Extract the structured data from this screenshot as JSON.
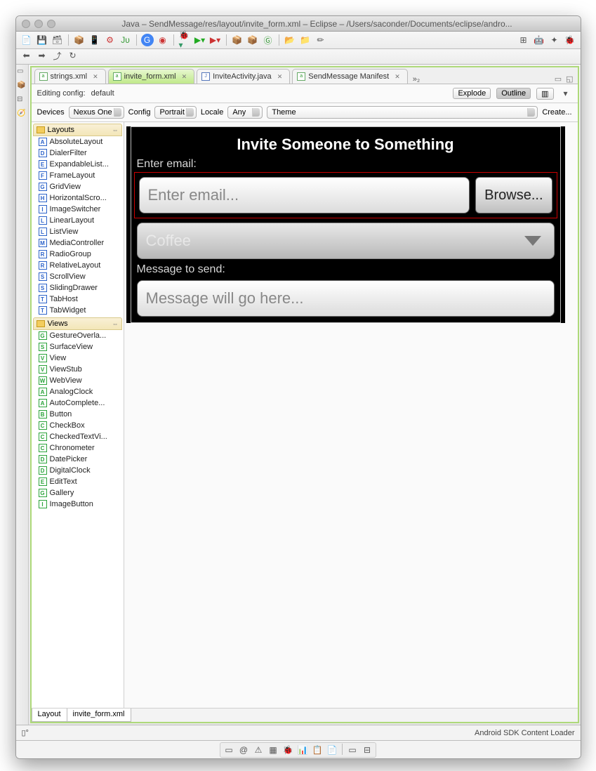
{
  "window": {
    "title": "Java – SendMessage/res/layout/invite_form.xml – Eclipse – /Users/saconder/Documents/eclipse/andro..."
  },
  "tabs": [
    {
      "label": "strings.xml",
      "active": false,
      "kind": "x"
    },
    {
      "label": "invite_form.xml",
      "active": true,
      "kind": "x"
    },
    {
      "label": "InviteActivity.java",
      "active": false,
      "kind": "j"
    },
    {
      "label": "SendMessage Manifest",
      "active": false,
      "kind": "x"
    }
  ],
  "tabs_more": "»₂",
  "cfg": {
    "prefix": "Editing config:",
    "value": "default",
    "explode": "Explode",
    "outline": "Outline"
  },
  "dev": {
    "devices_label": "Devices",
    "device": "Nexus One",
    "config_label": "Config",
    "config": "Portrait",
    "locale_label": "Locale",
    "locale": "Any",
    "theme": "Theme",
    "create": "Create..."
  },
  "palette": {
    "layouts_head": "Layouts",
    "layouts": [
      {
        "l": "A",
        "c": "#2b62c9",
        "t": "AbsoluteLayout"
      },
      {
        "l": "D",
        "c": "#2b62c9",
        "t": "DialerFilter"
      },
      {
        "l": "E",
        "c": "#2b62c9",
        "t": "ExpandableList..."
      },
      {
        "l": "F",
        "c": "#2b62c9",
        "t": "FrameLayout"
      },
      {
        "l": "G",
        "c": "#2b62c9",
        "t": "GridView"
      },
      {
        "l": "H",
        "c": "#2b62c9",
        "t": "HorizontalScro..."
      },
      {
        "l": "I",
        "c": "#2b62c9",
        "t": "ImageSwitcher"
      },
      {
        "l": "L",
        "c": "#2b62c9",
        "t": "LinearLayout"
      },
      {
        "l": "L",
        "c": "#2b62c9",
        "t": "ListView"
      },
      {
        "l": "M",
        "c": "#2b62c9",
        "t": "MediaController"
      },
      {
        "l": "R",
        "c": "#2b62c9",
        "t": "RadioGroup"
      },
      {
        "l": "R",
        "c": "#2b62c9",
        "t": "RelativeLayout"
      },
      {
        "l": "S",
        "c": "#2b62c9",
        "t": "ScrollView"
      },
      {
        "l": "S",
        "c": "#2b62c9",
        "t": "SlidingDrawer"
      },
      {
        "l": "T",
        "c": "#2b62c9",
        "t": "TabHost"
      },
      {
        "l": "T",
        "c": "#2b62c9",
        "t": "TabWidget"
      }
    ],
    "views_head": "Views",
    "views": [
      {
        "l": "G",
        "c": "#2aa33a",
        "t": "GestureOverla..."
      },
      {
        "l": "S",
        "c": "#2aa33a",
        "t": "SurfaceView"
      },
      {
        "l": "V",
        "c": "#2aa33a",
        "t": "View"
      },
      {
        "l": "V",
        "c": "#2aa33a",
        "t": "ViewStub"
      },
      {
        "l": "W",
        "c": "#2aa33a",
        "t": "WebView"
      },
      {
        "l": "A",
        "c": "#2aa33a",
        "t": "AnalogClock"
      },
      {
        "l": "A",
        "c": "#2aa33a",
        "t": "AutoComplete..."
      },
      {
        "l": "B",
        "c": "#2aa33a",
        "t": "Button"
      },
      {
        "l": "C",
        "c": "#2aa33a",
        "t": "CheckBox"
      },
      {
        "l": "C",
        "c": "#2aa33a",
        "t": "CheckedTextVi..."
      },
      {
        "l": "C",
        "c": "#2aa33a",
        "t": "Chronometer"
      },
      {
        "l": "D",
        "c": "#2aa33a",
        "t": "DatePicker"
      },
      {
        "l": "D",
        "c": "#2aa33a",
        "t": "DigitalClock"
      },
      {
        "l": "E",
        "c": "#2aa33a",
        "t": "EditText"
      },
      {
        "l": "G",
        "c": "#2aa33a",
        "t": "Gallery"
      },
      {
        "l": "I",
        "c": "#2aa33a",
        "t": "ImageButton"
      }
    ]
  },
  "form": {
    "title": "Invite Someone to Something",
    "email_label": "Enter email:",
    "email_hint": "Enter email...",
    "browse": "Browse...",
    "spinner": "Coffee",
    "message_label": "Message to send:",
    "message_hint": "Message will go here..."
  },
  "bottom_tabs": {
    "layout": "Layout",
    "xml": "invite_form.xml"
  },
  "status": {
    "loader": "Android SDK Content Loader"
  }
}
